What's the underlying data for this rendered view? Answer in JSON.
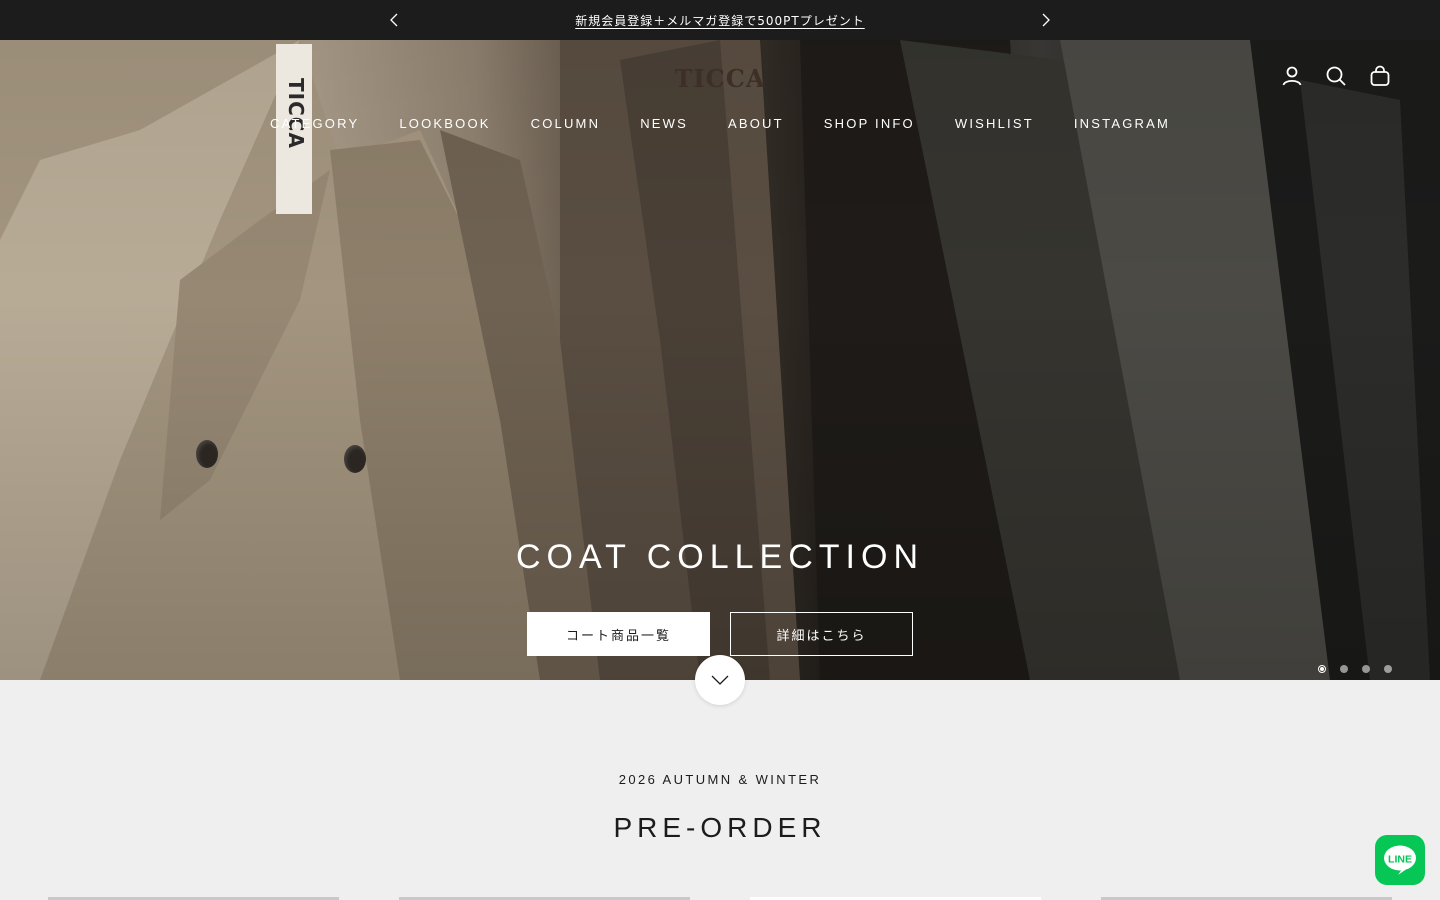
{
  "announcement": {
    "message": "新規会員登録＋メルマガ登録で500PTプレゼント",
    "prev_icon": "chevron-left-icon",
    "next_icon": "chevron-right-icon"
  },
  "header": {
    "logo": "TICCA",
    "icons": [
      "account-icon",
      "search-icon",
      "cart-icon"
    ]
  },
  "nav": {
    "items": [
      "CATEGORY",
      "LOOKBOOK",
      "COLUMN",
      "NEWS",
      "ABOUT",
      "SHOP INFO",
      "WISHLIST",
      "INSTAGRAM"
    ]
  },
  "hero": {
    "tag_text": "TICCA",
    "title": "COAT COLLECTION",
    "primary_button": "コート商品一覧",
    "secondary_button": "詳細はこちら",
    "slide_count": 4,
    "active_slide": 1,
    "scroll_icon": "chevron-down-icon"
  },
  "section": {
    "season": "2026 AUTUMN & WINTER",
    "title": "PRE-ORDER"
  },
  "line": {
    "label": "LINE",
    "color": "#06c755"
  },
  "colors": {
    "announcement_bg": "#1c1c1c",
    "page_bg": "#efefef"
  }
}
